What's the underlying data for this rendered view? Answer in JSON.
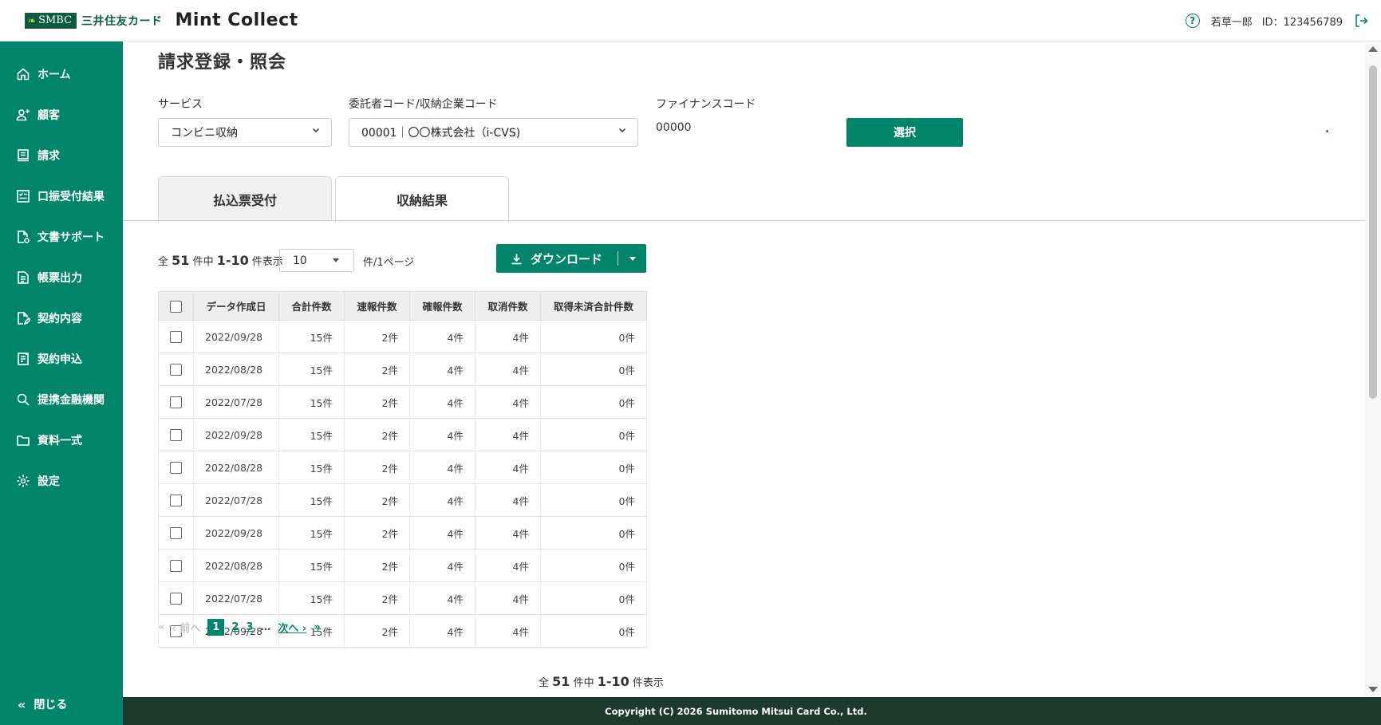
{
  "header": {
    "brand_mark": "SMBC",
    "brand_card": "三井住友カード",
    "app_title": "Mint Collect",
    "user_name": "若草一郎",
    "user_id": "ID：123456789"
  },
  "sidebar": {
    "items": [
      {
        "label": "ホーム",
        "icon": "home-icon"
      },
      {
        "label": "顧客",
        "icon": "users-icon"
      },
      {
        "label": "請求",
        "icon": "invoice-icon"
      },
      {
        "label": "口振受付結果",
        "icon": "checklist-icon"
      },
      {
        "label": "文書サポート",
        "icon": "document-settings-icon"
      },
      {
        "label": "帳票出力",
        "icon": "report-icon"
      },
      {
        "label": "契約内容",
        "icon": "contract-edit-icon"
      },
      {
        "label": "契約申込",
        "icon": "application-icon"
      },
      {
        "label": "提携金融機関",
        "icon": "search-icon"
      },
      {
        "label": "資料一式",
        "icon": "folder-icon"
      },
      {
        "label": "設定",
        "icon": "gear-icon"
      }
    ],
    "close_label": "閉じる"
  },
  "main": {
    "page_title": "請求登録・照会",
    "service": {
      "label": "サービス",
      "value": "コンビニ収納"
    },
    "consignor": {
      "label": "委託者コード/収納企業コード",
      "value": "00001｜〇〇株式会社（i-CVS)"
    },
    "finance": {
      "label": "ファイナンスコード",
      "value": "00000"
    },
    "select_button": "選択",
    "tabs": [
      {
        "label": "払込票受付",
        "active": false
      },
      {
        "label": "収納結果",
        "active": true
      }
    ],
    "count": {
      "prefix": "全",
      "total": "51",
      "mid": "件中",
      "range": "1-10",
      "suffix": "件表示"
    },
    "per_page": {
      "value": "10",
      "suffix": "件/1ページ"
    },
    "download_label": "ダウンロード",
    "table": {
      "headers": [
        "データ作成日",
        "合計件数",
        "速報件数",
        "確報件数",
        "取消件数",
        "取得未済合計件数"
      ],
      "rows": [
        [
          "2022/09/28",
          "15件",
          "2件",
          "4件",
          "4件",
          "0件"
        ],
        [
          "2022/08/28",
          "15件",
          "2件",
          "4件",
          "4件",
          "0件"
        ],
        [
          "2022/07/28",
          "15件",
          "2件",
          "4件",
          "4件",
          "0件"
        ],
        [
          "2022/09/28",
          "15件",
          "2件",
          "4件",
          "4件",
          "0件"
        ],
        [
          "2022/08/28",
          "15件",
          "2件",
          "4件",
          "4件",
          "0件"
        ],
        [
          "2022/07/28",
          "15件",
          "2件",
          "4件",
          "4件",
          "0件"
        ],
        [
          "2022/09/28",
          "15件",
          "2件",
          "4件",
          "4件",
          "0件"
        ],
        [
          "2022/08/28",
          "15件",
          "2件",
          "4件",
          "4件",
          "0件"
        ],
        [
          "2022/07/28",
          "15件",
          "2件",
          "4件",
          "4件",
          "0件"
        ],
        [
          "2022/09/28",
          "15件",
          "2件",
          "4件",
          "4件",
          "0件"
        ]
      ]
    },
    "pagination": {
      "first": "«",
      "prev": "‹ 前へ",
      "pages": [
        "1",
        "2",
        "3"
      ],
      "current": "1",
      "ellipsis": "…",
      "next": "次へ ›",
      "last": "»"
    }
  },
  "footer": {
    "copyright": "Copyright (C) 2026 Sumitomo Mitsui Card Co., Ltd."
  },
  "colors": {
    "accent": "#00856a",
    "footer": "#1d3a2e",
    "brand": "#0c5b3e"
  }
}
